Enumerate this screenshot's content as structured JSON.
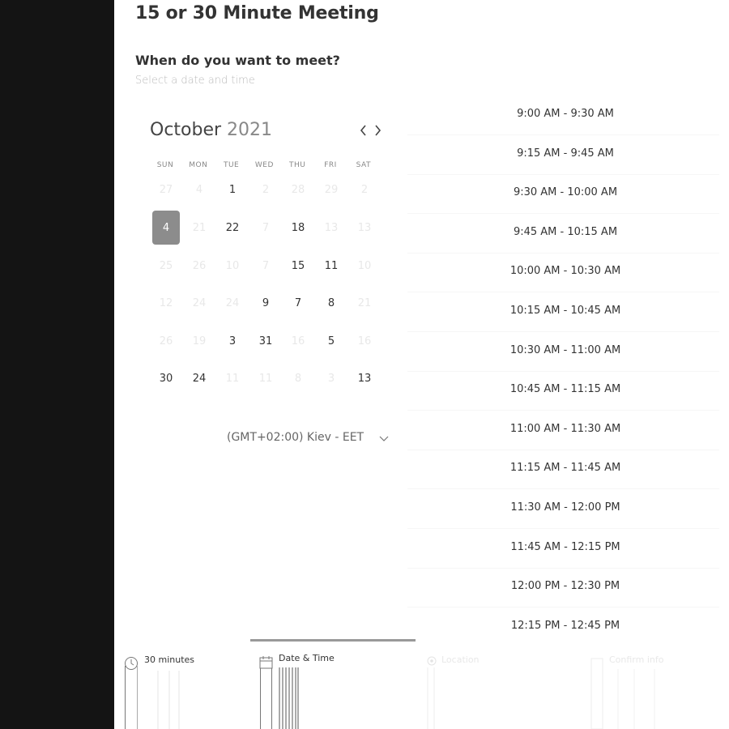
{
  "page": {
    "title": "15 or 30 Minute Meeting",
    "question": "When do you want to meet?",
    "hint": "Select a date and time"
  },
  "calendar": {
    "month": "October",
    "year": "2021",
    "prev_icon": "chevron-left-icon",
    "next_icon": "chevron-right-icon",
    "weekdays": [
      "SUN",
      "MON",
      "TUE",
      "WED",
      "THU",
      "FRI",
      "SAT"
    ],
    "weeks": [
      [
        {
          "d": "27",
          "m": true
        },
        {
          "d": "4",
          "m": true
        },
        {
          "d": "1",
          "m": false
        },
        {
          "d": "2",
          "m": true
        },
        {
          "d": "28",
          "m": true
        },
        {
          "d": "29",
          "m": true
        },
        {
          "d": "2",
          "m": true
        }
      ],
      [
        {
          "d": "4",
          "m": false,
          "sel": true
        },
        {
          "d": "21",
          "m": true
        },
        {
          "d": "22",
          "m": false
        },
        {
          "d": "7",
          "m": true
        },
        {
          "d": "18",
          "m": false
        },
        {
          "d": "13",
          "m": true
        },
        {
          "d": "13",
          "m": true
        }
      ],
      [
        {
          "d": "25",
          "m": true
        },
        {
          "d": "26",
          "m": true
        },
        {
          "d": "10",
          "m": true
        },
        {
          "d": "7",
          "m": true
        },
        {
          "d": "15",
          "m": false
        },
        {
          "d": "11",
          "m": false
        },
        {
          "d": "10",
          "m": true
        }
      ],
      [
        {
          "d": "12",
          "m": true
        },
        {
          "d": "24",
          "m": true
        },
        {
          "d": "24",
          "m": true
        },
        {
          "d": "9",
          "m": false
        },
        {
          "d": "7",
          "m": false
        },
        {
          "d": "8",
          "m": false
        },
        {
          "d": "21",
          "m": true
        }
      ],
      [
        {
          "d": "26",
          "m": true
        },
        {
          "d": "19",
          "m": true
        },
        {
          "d": "3",
          "m": false
        },
        {
          "d": "31",
          "m": false
        },
        {
          "d": "16",
          "m": true
        },
        {
          "d": "5",
          "m": false
        },
        {
          "d": "16",
          "m": true
        }
      ],
      [
        {
          "d": "30",
          "m": false
        },
        {
          "d": "24",
          "m": false
        },
        {
          "d": "11",
          "m": true
        },
        {
          "d": "11",
          "m": true
        },
        {
          "d": "8",
          "m": true
        },
        {
          "d": "3",
          "m": true
        },
        {
          "d": "13",
          "m": false
        }
      ]
    ],
    "selected_day": "4"
  },
  "timezone": {
    "label": "(GMT+02:00) Kiev - EET",
    "icon": "chevron-down-icon"
  },
  "time_slots": [
    "9:00 AM - 9:30 AM",
    "9:15 AM - 9:45 AM",
    "9:30 AM - 10:00 AM",
    "9:45 AM - 10:15 AM",
    "10:00 AM - 10:30 AM",
    "10:15 AM - 10:45 AM",
    "10:30 AM - 11:00 AM",
    "10:45 AM - 11:15 AM",
    "11:00 AM - 11:30 AM",
    "11:15 AM - 11:45 AM",
    "11:30 AM - 12:00 PM",
    "11:45 AM - 12:15 PM",
    "12:00 PM - 12:30 PM",
    "12:15 PM - 12:45 PM"
  ],
  "steps": [
    {
      "label": "30 minutes",
      "icon": "clock-icon",
      "state": "done"
    },
    {
      "label": "Date & Time",
      "icon": "calendar-icon",
      "state": "active"
    },
    {
      "label": "Location",
      "icon": "location-pin-icon",
      "state": "pending"
    },
    {
      "label": "Confirm info",
      "icon": "form-icon",
      "state": "pending"
    }
  ],
  "colors": {
    "sidebar": "#141414",
    "selected_day": "#8c8c8c",
    "muted_text": "#e8e8e8",
    "progress": "#999999"
  }
}
